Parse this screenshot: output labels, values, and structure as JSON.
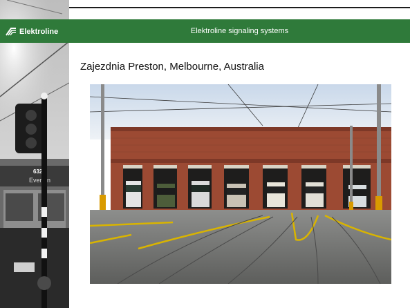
{
  "header": {
    "logo_text": "Elektroline",
    "title": "Elektroline signaling systems"
  },
  "slide": {
    "heading": "Zajezdnia Preston, Melbourne, Australia"
  },
  "left_photo": {
    "tram_number": "632",
    "tram_sign": "Everton"
  },
  "colors": {
    "header_green": "#2f7a3a",
    "brick": "#9c4a33",
    "track_yellow": "#d9b400"
  }
}
